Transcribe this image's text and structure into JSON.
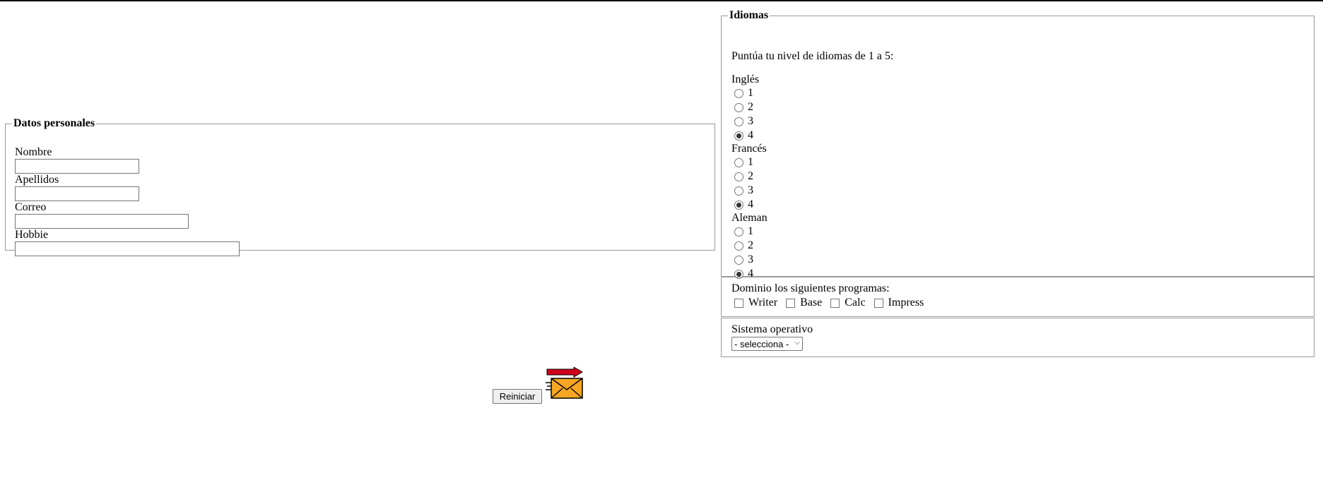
{
  "personal": {
    "legend": "Datos personales",
    "fields": [
      {
        "label": "Nombre",
        "value": ""
      },
      {
        "label": "Apellidos",
        "value": ""
      },
      {
        "label": "Correo",
        "value": ""
      },
      {
        "label": "Hobbie",
        "value": ""
      }
    ]
  },
  "idiomas": {
    "legend": "Idiomas",
    "intro": "Puntúa tu nivel de idiomas de 1 a 5:",
    "languages": [
      {
        "name": "Inglés",
        "options": [
          "1",
          "2",
          "3",
          "4"
        ],
        "selected": "4"
      },
      {
        "name": "Francés",
        "options": [
          "1",
          "2",
          "3",
          "4"
        ],
        "selected": "4"
      },
      {
        "name": "Aleman",
        "options": [
          "1",
          "2",
          "3",
          "4"
        ],
        "selected": "4"
      }
    ]
  },
  "programas": {
    "question": "Dominio los siguientes programas:",
    "items": [
      "Writer",
      "Base",
      "Calc",
      "Impress"
    ]
  },
  "so": {
    "label": "Sistema operativo",
    "selected": "- selecciona -"
  },
  "actions": {
    "reset_label": "Reiniciar",
    "send_icon": "send-mail-icon"
  },
  "colors": {
    "envelope": "#f5a623",
    "arrow": "#d0021b"
  }
}
